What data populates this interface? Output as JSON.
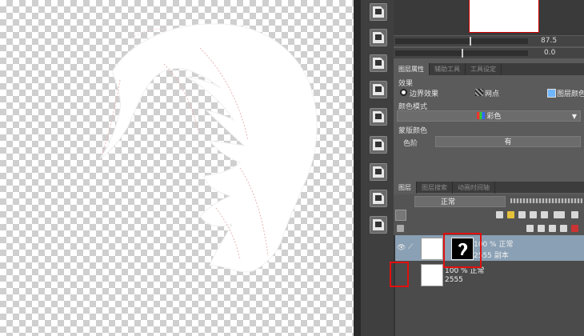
{
  "props": {
    "tabs": [
      "图层属性",
      "辅助工具",
      "工具设定"
    ],
    "effect_label": "效果",
    "effects": [
      "边界效果",
      "网点",
      "图层颜色"
    ],
    "color_mode_label": "颜色模式",
    "color_mode_value": "彩色",
    "mask_color_label": "蒙版颜色",
    "level_label": "色阶",
    "level_value": "有"
  },
  "navigator": {
    "zoom": "87.5",
    "rotation": "0.0"
  },
  "layers": {
    "tabs": [
      "图层",
      "图层搜索",
      "动画时间轴"
    ],
    "blend_mode": "正常",
    "items": [
      {
        "mode": "100 % 正常",
        "name": "2555 副本",
        "selected": true,
        "has_mask": true
      },
      {
        "mode": "100 % 正常",
        "name": "2555",
        "selected": false,
        "has_mask": false
      }
    ]
  },
  "colors": {
    "highlight": "#e01010",
    "selected_layer": "#8aa0b4",
    "panel_bg": "#5b5b5b"
  }
}
